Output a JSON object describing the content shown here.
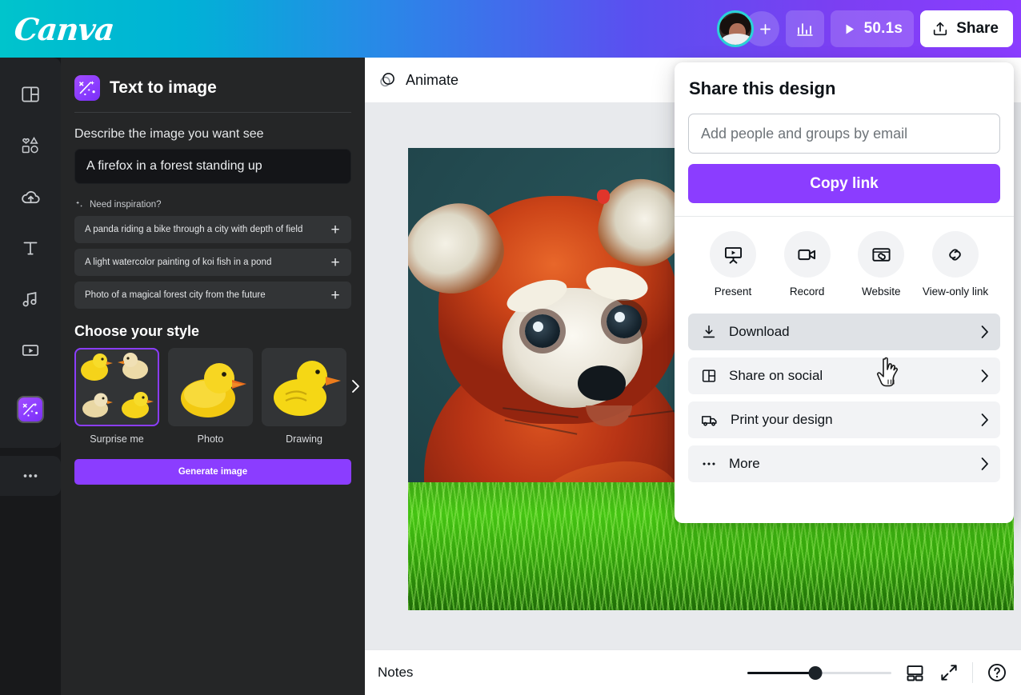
{
  "topbar": {
    "logo": "Canva",
    "add_label": "+",
    "stats_icon": "bar-chart-icon",
    "play_icon": "play-icon",
    "duration": "50.1s",
    "share_label": "Share",
    "share_icon": "share-upload-icon",
    "avatar": "user-avatar"
  },
  "rail": {
    "items": [
      {
        "name": "design",
        "icon": "layout-icon"
      },
      {
        "name": "elements",
        "icon": "shapes-icon"
      },
      {
        "name": "uploads",
        "icon": "cloud-upload-icon"
      },
      {
        "name": "text",
        "icon": "text-t-icon"
      },
      {
        "name": "audio",
        "icon": "music-note-icon"
      },
      {
        "name": "videos",
        "icon": "video-play-icon"
      },
      {
        "name": "apps-magic",
        "icon": "magic-wand-icon",
        "active": true
      }
    ],
    "more_icon": "more-dots-icon"
  },
  "panel": {
    "title": "Text to image",
    "icon": "magic-wand-icon",
    "field_label": "Describe the image you want see",
    "prompt_value": "A firefox in a forest standing up",
    "inspiration_label": "Need inspiration?",
    "inspiration_icon": "sparkles-icon",
    "suggestions": [
      {
        "text": "A panda riding a bike through a city with depth of field",
        "add": "+"
      },
      {
        "text": "A light watercolor painting of koi fish in a pond",
        "add": "+"
      },
      {
        "text": "Photo of a magical forest city from the future",
        "add": "+"
      }
    ],
    "style_section_title": "Choose your style",
    "styles": [
      {
        "label": "Surprise me",
        "thumb": "four-ducks-grid"
      },
      {
        "label": "Photo",
        "thumb": "photo-duck"
      },
      {
        "label": "Drawing",
        "thumb": "drawing-duck"
      }
    ],
    "carousel_next_icon": "chevron-right-icon",
    "generate_label": "Generate image"
  },
  "editor": {
    "animate_label": "Animate",
    "animate_icon": "animate-circles-icon",
    "artwork": "red-panda-in-grass"
  },
  "share": {
    "title": "Share this design",
    "email_placeholder": "Add people and groups by email",
    "copy_link_label": "Copy link",
    "actions": [
      {
        "label": "Present",
        "icon": "present-easel-icon"
      },
      {
        "label": "Record",
        "icon": "record-camcorder-icon"
      },
      {
        "label": "Website",
        "icon": "website-browser-icon"
      },
      {
        "label": "View-only link",
        "icon": "link-chain-icon"
      }
    ],
    "menu": [
      {
        "label": "Download",
        "icon": "download-arrow-icon",
        "hovered": true
      },
      {
        "label": "Share on social",
        "icon": "social-panels-icon",
        "hovered": false
      },
      {
        "label": "Print your design",
        "icon": "print-truck-icon",
        "hovered": false
      },
      {
        "label": "More",
        "icon": "more-dots-icon",
        "hovered": false
      }
    ],
    "chevron_icon": "chevron-right-icon",
    "cursor": "pointing-hand-cursor",
    "accent_color": "#8b3dff"
  },
  "bottombar": {
    "notes_label": "Notes",
    "zoom_percent": 47,
    "grid_icon": "grid-view-icon",
    "fullscreen_icon": "fullscreen-icon",
    "help_icon": "help-question-icon"
  }
}
